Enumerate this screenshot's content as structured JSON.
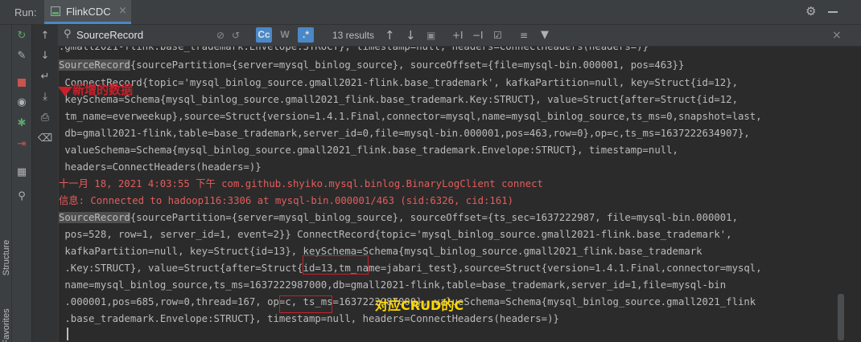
{
  "run_panel": {
    "label": "Run:",
    "tab": {
      "label": "FlinkCDC"
    }
  },
  "search": {
    "query": "SourceRecord",
    "results": "13 results",
    "toggles": [
      {
        "label": "Cc",
        "state": "on"
      },
      {
        "label": "W",
        "state": "off"
      },
      {
        "label": ".*",
        "state": "on"
      }
    ]
  },
  "left_sidebar": {
    "structure_label": "Structure",
    "favorites_label": "Favorites"
  },
  "console_lines": [
    {
      "text": ".gmall2021-flink.base_trademark.Envelope:STRUCT}, timestamp=null, headers=ConnectHeaders(headers=)}"
    },
    {
      "prefix": "",
      "match": "SourceRecord",
      "text": "{sourcePartition={server=mysql_binlog_source}, sourceOffset={file=mysql-bin.000001, pos=463}}"
    },
    {
      "text": " ConnectRecord{topic='mysql_binlog_source.gmall2021-flink.base_trademark', kafkaPartition=null, key=Struct{id=12},"
    },
    {
      "text": " keySchema=Schema{mysql_binlog_source.gmall2021_flink.base_trademark.Key:STRUCT}, value=Struct{after=Struct{id=12,"
    },
    {
      "text": " tm_name=everweekup},source=Struct{version=1.4.1.Final,connector=mysql,name=mysql_binlog_source,ts_ms=0,snapshot=last,"
    },
    {
      "text": " db=gmall2021-flink,table=base_trademark,server_id=0,file=mysql-bin.000001,pos=463,row=0},op=c,ts_ms=1637222634907},"
    },
    {
      "text": " valueSchema=Schema{mysql_binlog_source.gmall2021_flink.base_trademark.Envelope:STRUCT}, timestamp=null,"
    },
    {
      "text": " headers=ConnectHeaders(headers=)}"
    },
    {
      "text": "十一月 18, 2021 4:03:55 下午 com.github.shyiko.mysql.binlog.BinaryLogClient connect",
      "style": "err"
    },
    {
      "text": "信息: Connected to hadoop116:3306 at mysql-bin.000001/463 (sid:6326, cid:161)",
      "style": "err"
    },
    {
      "prefix": "",
      "match": "SourceRecord",
      "text": "{sourcePartition={server=mysql_binlog_source}, sourceOffset={ts_sec=1637222987, file=mysql-bin.000001,"
    },
    {
      "text": " pos=528, row=1, server_id=1, event=2}} ConnectRecord{topic='mysql_binlog_source.gmall2021-flink.base_trademark',"
    },
    {
      "text": " kafkaPartition=null, key=Struct{id=13}, keySchema=Schema{mysql_binlog_source.gmall2021_flink.base_trademark"
    },
    {
      "text": " .Key:STRUCT}, value=Struct{after=Struct{id=13,tm_name=jabari_test},source=Struct{version=1.4.1.Final,connector=mysql,"
    },
    {
      "text": " name=mysql_binlog_source,ts_ms=1637222987000,db=gmall2021-flink,table=base_trademark,server_id=1,file=mysql-bin"
    },
    {
      "text": " .000001,pos=685,row=0,thread=167, op=c, ts_ms=1637222987000}, valueSchema=Schema{mysql_binlog_source.gmall2021_flink"
    },
    {
      "text": " .base_trademark.Envelope:STRUCT}, timestamp=null, headers=ConnectHeaders(headers=)}"
    }
  ],
  "annotations": {
    "red_text": "新增的数据",
    "yellow_text": "对应CRUD的C"
  }
}
